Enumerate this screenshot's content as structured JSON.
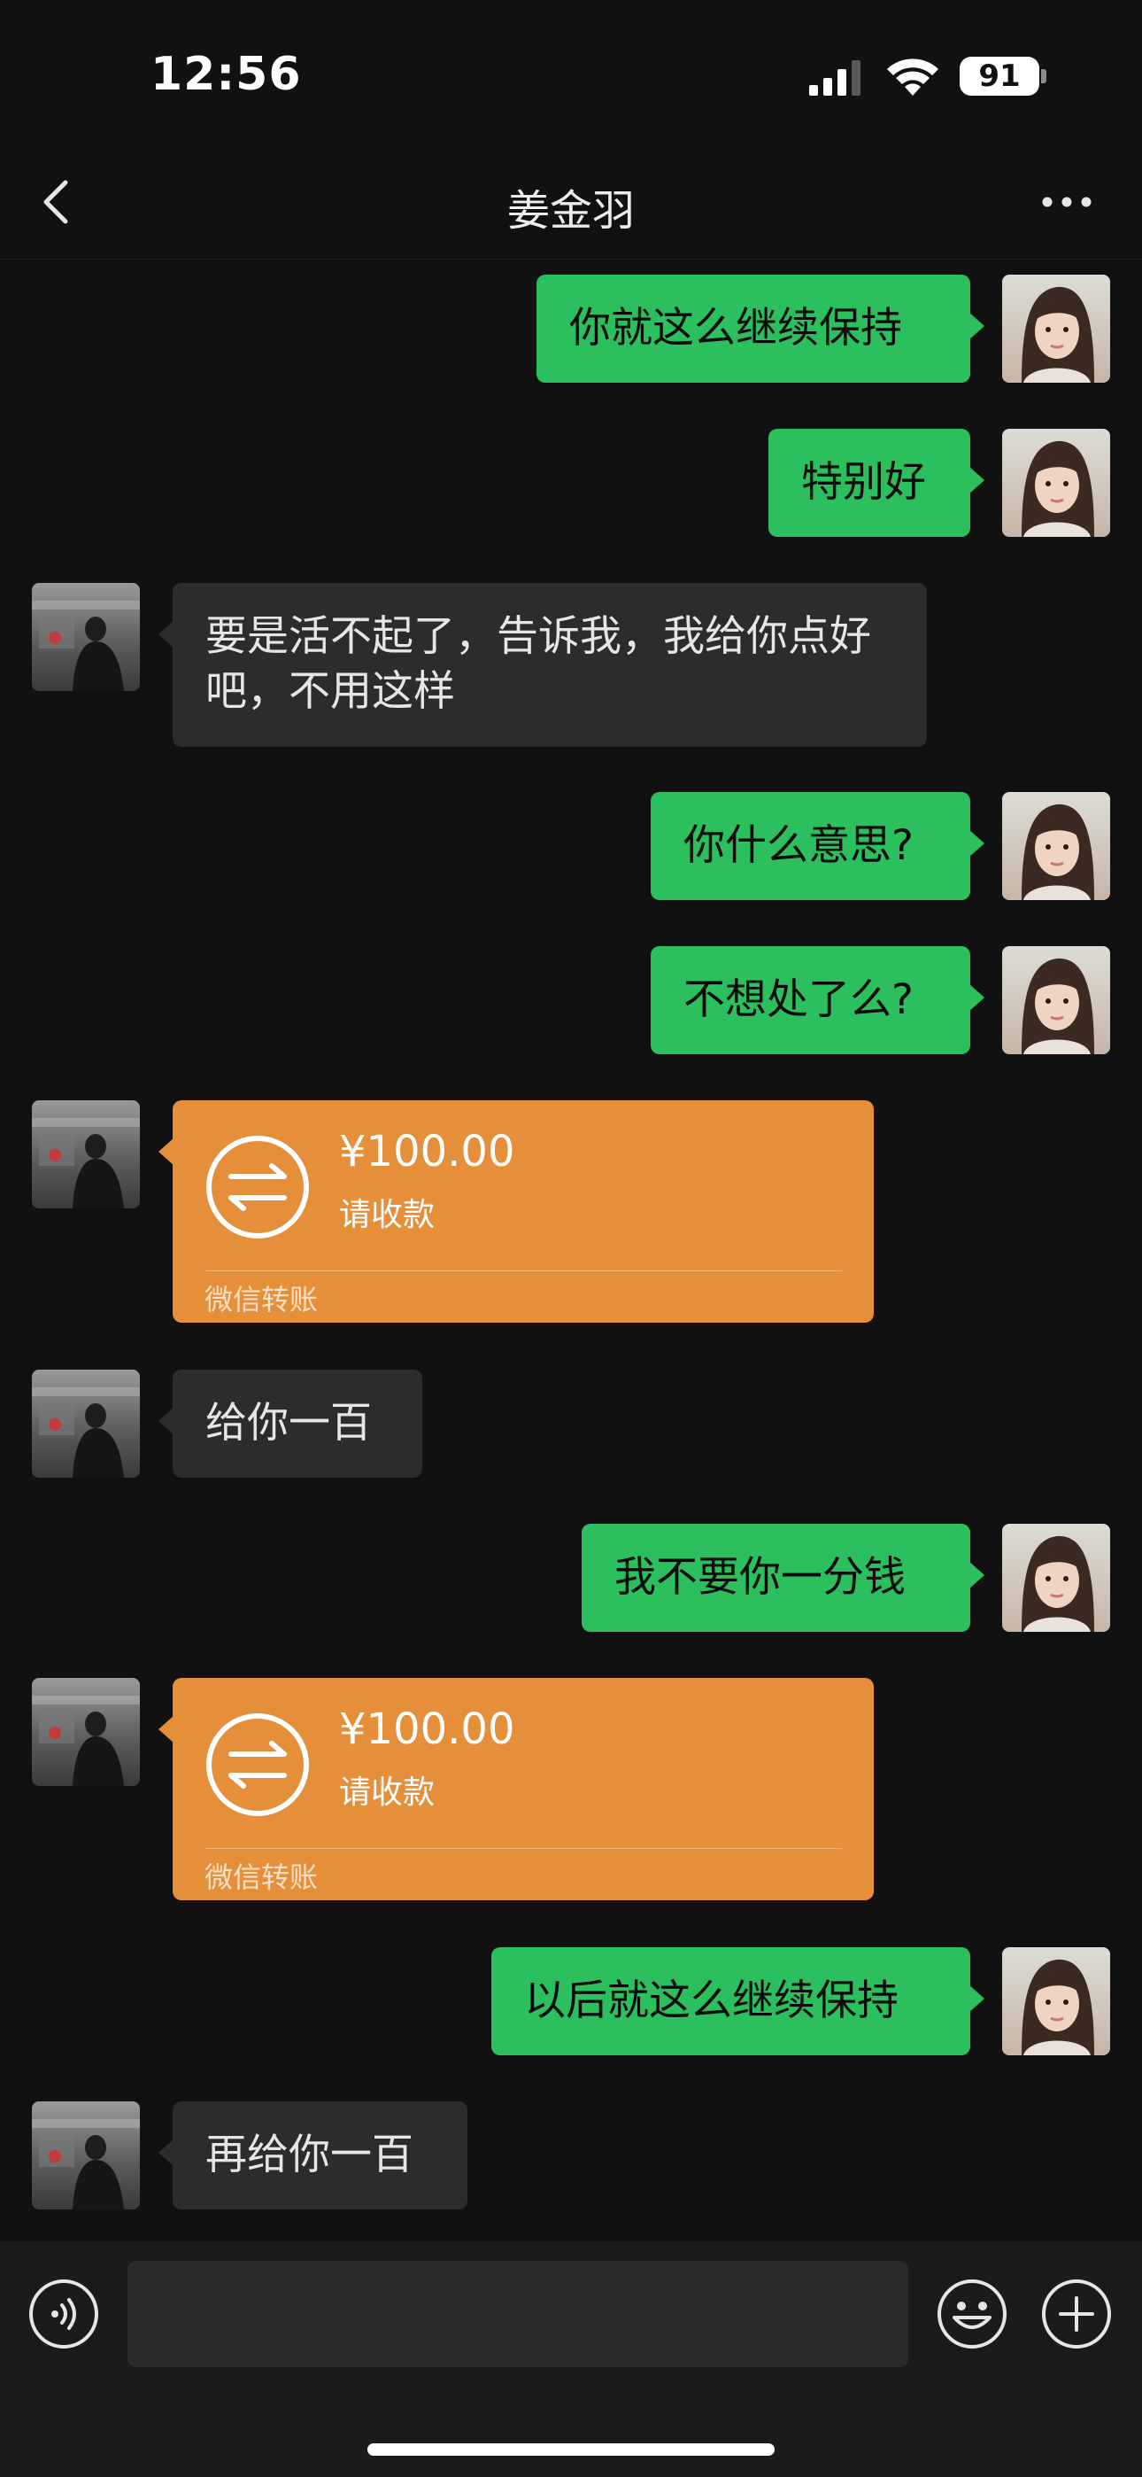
{
  "status_bar": {
    "time": "12:56",
    "battery": "91"
  },
  "header": {
    "title": "姜金羽"
  },
  "messages": [
    {
      "from": "me",
      "type": "text",
      "text": "你就这么继续保持"
    },
    {
      "from": "me",
      "type": "text",
      "text": "特别好"
    },
    {
      "from": "peer",
      "type": "text",
      "text": "要是活不起了，告诉我，我给你点好吧，不用这样"
    },
    {
      "from": "me",
      "type": "text",
      "text": "你什么意思?"
    },
    {
      "from": "me",
      "type": "text",
      "text": "不想处了么?"
    },
    {
      "from": "peer",
      "type": "transfer",
      "amount": "¥100.00",
      "status": "请收款",
      "label": "微信转账"
    },
    {
      "from": "peer",
      "type": "text",
      "text": "给你一百"
    },
    {
      "from": "me",
      "type": "text",
      "text": "我不要你一分钱"
    },
    {
      "from": "peer",
      "type": "transfer",
      "amount": "¥100.00",
      "status": "请收款",
      "label": "微信转账"
    },
    {
      "from": "me",
      "type": "text",
      "text": "以后就这么继续保持"
    },
    {
      "from": "peer",
      "type": "text",
      "text": "再给你一百"
    }
  ],
  "input_bar": {
    "placeholder": ""
  },
  "colors": {
    "outgoing_bubble": "#2cbf5d",
    "incoming_bubble": "#2c2c2c",
    "transfer_card": "#e58f3a",
    "background": "#111111"
  },
  "icons": [
    "back-arrow-icon",
    "more-icon",
    "voice-icon",
    "emoji-icon",
    "add-icon",
    "transfer-icon"
  ]
}
